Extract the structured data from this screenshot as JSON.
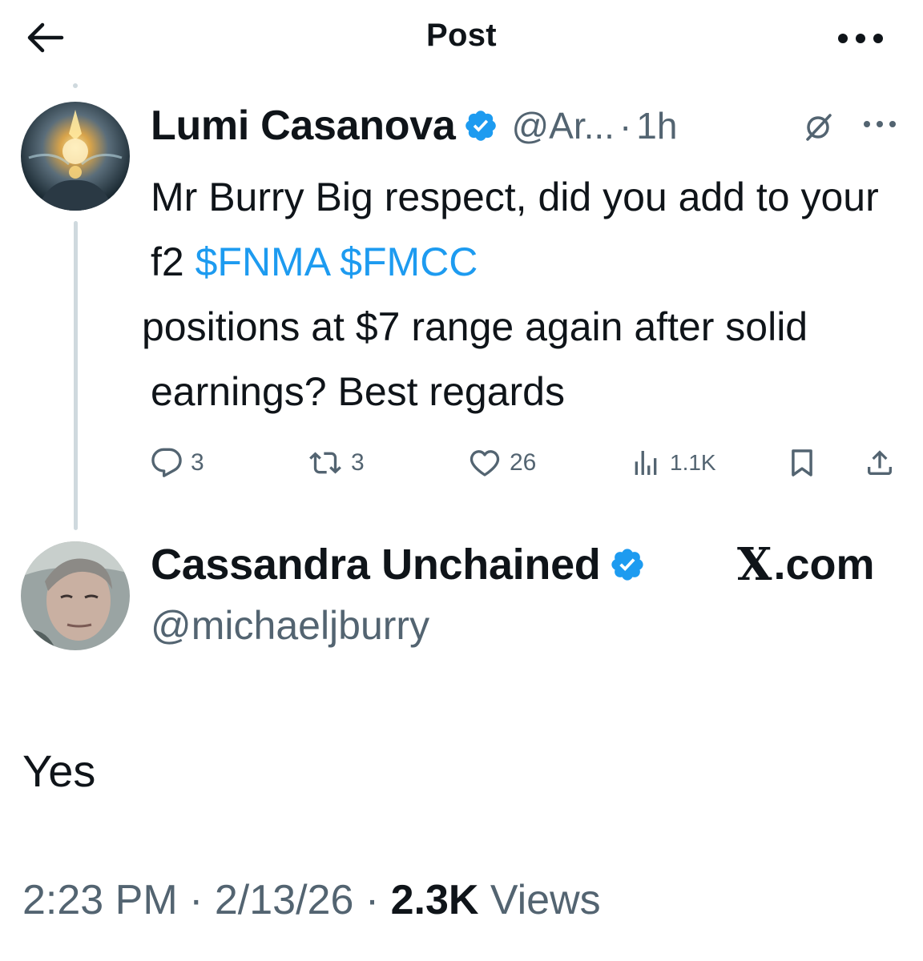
{
  "header": {
    "title": "Post"
  },
  "reply": {
    "author_name": "Lumi Casanova",
    "handle": "@Ar...",
    "separator": "·",
    "time": "1h",
    "text_parts": {
      "line_a": "Mr Burry Big respect, did you add to your f2 ",
      "cashtag_1": "$FNMA",
      "space": " ",
      "cashtag_2": "$FMCC",
      "line_b": " positions at $7 range again after solid earnings? Best regards"
    },
    "stats": {
      "replies": "3",
      "reposts": "3",
      "likes": "26",
      "views": "1.1K"
    }
  },
  "main_post": {
    "author_name": "Cassandra Unchained",
    "source": ".com",
    "source_mark": "X",
    "handle": "@michaeljburry",
    "text": "Yes",
    "timestamp": "2:23 PM",
    "sep1": " · ",
    "date": "2/13/26",
    "sep2": " · ",
    "views_count": "2.3K",
    "views_label": " Views"
  },
  "colors": {
    "accent": "#1d9bf0",
    "text": "#0f1419",
    "secondary": "#536471",
    "thread_line": "#cfd9de"
  },
  "icons": {
    "back": "arrow-left-icon",
    "more": "more-horizontal-icon",
    "verified": "verified-badge-icon",
    "grok": "grok-icon",
    "reply": "reply-bubble-icon",
    "repost": "repost-icon",
    "like": "heart-icon",
    "views": "views-bars-icon",
    "bookmark": "bookmark-icon",
    "share": "share-icon"
  }
}
